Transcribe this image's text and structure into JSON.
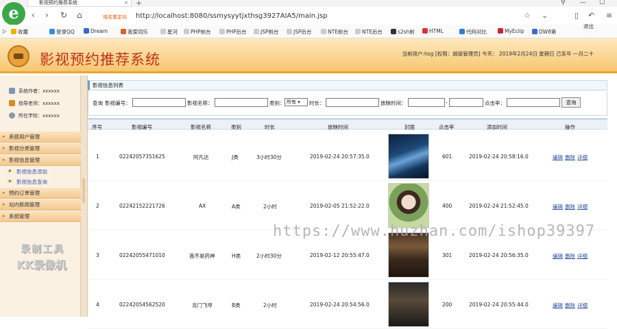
{
  "browser": {
    "tab_title": "影视预约推荐系统",
    "tab_close": "×",
    "new_tab": "+",
    "logo": "e",
    "redirect_tag": "域名重定向",
    "url": "http://localhost:8080/ssmysyytjxthsg3927AIA5/main.jsp",
    "bookmarks": [
      "收藏",
      "登录QQ",
      "Dream",
      "我爱同乐",
      "星河",
      "PHP前台",
      "PHP后台",
      "JSP前台",
      "JSP后台",
      "NTE前台",
      "NTE后台",
      "s2sh前",
      "HTML",
      "代码对比",
      "MyEclip",
      "DW8第"
    ]
  },
  "header": {
    "title": "影视预约推荐系统",
    "user_info": "当前用户:hsg [权限：超级管理员] 今天： 2019年2月24日 星期日 己亥年 一月二十",
    "logout": "退出"
  },
  "sidebar": {
    "info": [
      {
        "icon": "user-icon",
        "label": "系统作者：xxxxxx"
      },
      {
        "icon": "teacher-icon",
        "label": "指导老师：xxxxxx"
      },
      {
        "icon": "school-icon",
        "label": "所在学校：xxxxxx"
      }
    ],
    "menus": [
      {
        "label": "系统用户管理"
      },
      {
        "label": "影视分类管理"
      },
      {
        "label": "影视信息管理"
      },
      {
        "label": "预约订单管理"
      },
      {
        "label": "站内新闻管理"
      },
      {
        "label": "系统管理"
      }
    ],
    "submenus": [
      {
        "label": "影视信息添加"
      },
      {
        "label": "影视信息查询"
      }
    ],
    "watermark_line1": "录制工具",
    "watermark_line2": "KK录像机"
  },
  "panel": {
    "title": "影视信息列表"
  },
  "search": {
    "label_query": "查询",
    "label_code": "影视编号：",
    "label_name": "影视名称：",
    "label_type": "类别：",
    "type_value": "所有",
    "label_duration": "时长：",
    "label_time": "放映时间：",
    "label_clicks": "点击率：",
    "button": "查询"
  },
  "table": {
    "headers": [
      "序号",
      "影视编号",
      "影视名称",
      "类别",
      "时长",
      "放映时间",
      "封面",
      "点击率",
      "添加时间",
      "操作"
    ],
    "rows": [
      {
        "no": "1",
        "code": "02242057351625",
        "name": "阿凡达",
        "type": "J类",
        "duration": "3小时30分",
        "show_time": "2019-02-24 20:57:35.0",
        "cover": "poster-blue",
        "clicks": "601",
        "added": "2019-02-24 20:58:16.0"
      },
      {
        "no": "2",
        "code": "02242152221726",
        "name": "AX",
        "type": "A类",
        "duration": "2小时",
        "show_time": "2019-02-05 21:52:22.0",
        "cover": "poster-green",
        "clicks": "400",
        "added": "2019-02-24 21:52:45.0"
      },
      {
        "no": "3",
        "code": "02242055471010",
        "name": "我不是药神",
        "type": "H类",
        "duration": "2小时30分",
        "show_time": "2019-02-12 20:55:47.0",
        "cover": "poster-brown",
        "clicks": "301",
        "added": "2019-02-24 20:56:35.0"
      },
      {
        "no": "4",
        "code": "02242054562520",
        "name": "龙门飞甲",
        "type": "B类",
        "duration": "2小时",
        "show_time": "2019-02-24 20:54:56.0",
        "cover": "poster-dark",
        "clicks": "200",
        "added": "2019-02-24 20:55:44.0"
      }
    ],
    "actions": [
      "编辑",
      "删除",
      "详细"
    ]
  },
  "overlay_watermark": "https://www.huzhan.com/ishop39397",
  "colors": {
    "header_bg": "#f8c66f",
    "title_red": "#c0301b",
    "link_blue": "#2a4d9b",
    "sidebar_bg": "#fbf1e3"
  }
}
